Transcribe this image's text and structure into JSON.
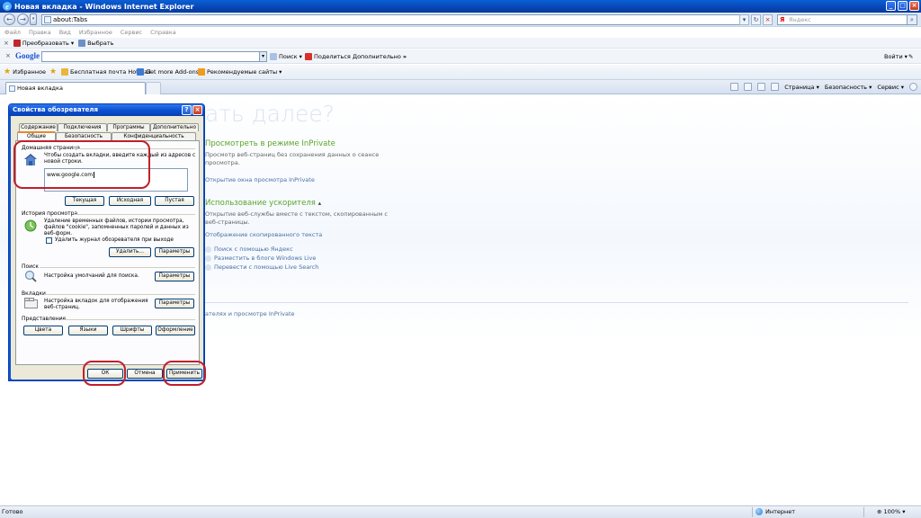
{
  "window": {
    "title": "Новая вкладка - Windows Internet Explorer"
  },
  "address": {
    "url": "about:Tabs",
    "search_placeholder": "Яндекс"
  },
  "menu": [
    "Файл",
    "Правка",
    "Вид",
    "Избранное",
    "Сервис",
    "Справка"
  ],
  "toolbar1": {
    "convert": "Преобразовать",
    "select": "Выбрать"
  },
  "googlebar": {
    "logo": "Google",
    "search": "Поиск",
    "share": "Поделиться",
    "more": "Дополнительно",
    "signin": "Войти"
  },
  "favorites": {
    "label": "Избранное",
    "hotmail": "Бесплатная почта Hotmail",
    "addons": "Get more Add-ons",
    "suggested": "Рекомендуемые сайты"
  },
  "tabs": {
    "active": "Новая вкладка"
  },
  "commands": {
    "page": "Страница",
    "security": "Безопасность",
    "tools": "Сервис"
  },
  "content": {
    "heading": "ать далее?",
    "inprivate_title": "Просмотреть в режиме InPrivate",
    "inprivate_text": "Просмотр веб-страниц без сохранения данных о сеансе просмотра.",
    "inprivate_link": "Открытие окна просмотра InPrivate",
    "accel_title": "Использование ускорителя",
    "accel_text": "Открытие веб-службы вместе с текстом, скопированным с веб-страницы.",
    "accel_link": "Отображение скопированного текста",
    "accel_items": [
      "Поиск с помощью Яндекс",
      "Разместить в блоге Windows Live",
      "Перевести с помощью Live Search"
    ],
    "footer_link": "ателях и просмотре InPrivate"
  },
  "status": {
    "text": "Готово",
    "zone": "Интернет",
    "zoom": "100%"
  },
  "dialog": {
    "title": "Свойства обозревателя",
    "tabs_top": [
      "Содержание",
      "Подключения",
      "Программы",
      "Дополнительно"
    ],
    "tabs_bottom": [
      "Общие",
      "Безопасность",
      "Конфиденциальность"
    ],
    "home": {
      "label": "Домашняя страница",
      "text": "Чтобы создать вкладки, введите каждый из адресов с новой строки.",
      "value": "www.google.com",
      "btn_current": "Текущая",
      "btn_default": "Исходная",
      "btn_blank": "Пустая"
    },
    "history": {
      "label": "История просмотра",
      "text": "Удаление временных файлов, истории просмотра, файлов \"cookie\", запомненных паролей и данных из веб-форм.",
      "checkbox": "Удалить журнал обозревателя при выходе",
      "btn_delete": "Удалить...",
      "btn_settings": "Параметры"
    },
    "search": {
      "label": "Поиск",
      "text": "Настройка умолчаний для поиска.",
      "btn_settings": "Параметры"
    },
    "tabs_group": {
      "label": "Вкладки",
      "text": "Настройка вкладок для отображения веб-страниц.",
      "btn_settings": "Параметры"
    },
    "appearance": {
      "label": "Представление",
      "btn_colors": "Цвета",
      "btn_languages": "Языки",
      "btn_fonts": "Шрифты",
      "btn_design": "Оформление"
    },
    "footer": {
      "ok": "ОК",
      "cancel": "Отмена",
      "apply": "Применить"
    }
  }
}
